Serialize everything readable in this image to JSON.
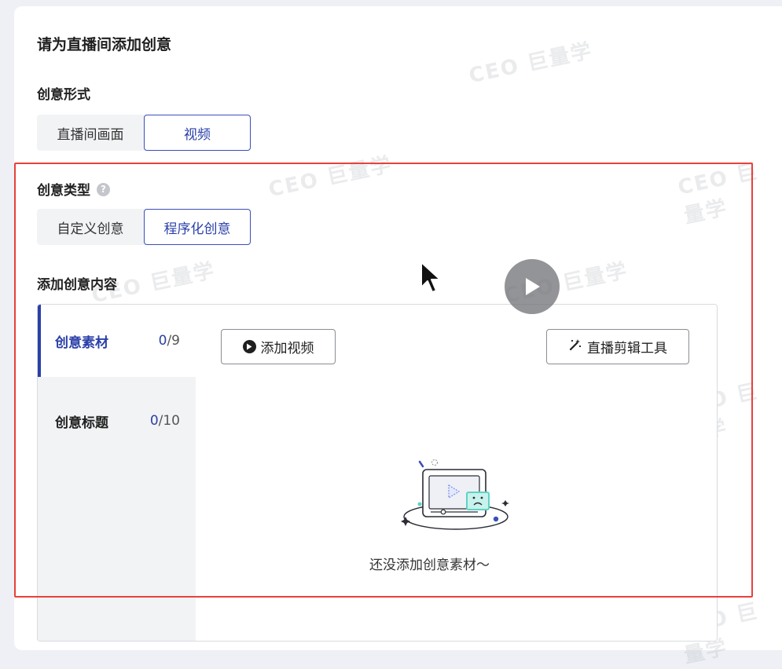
{
  "page": {
    "title": "请为直播间添加创意"
  },
  "creative_form": {
    "label": "创意形式",
    "options": [
      "直播间画面",
      "视频"
    ],
    "selected": "视频"
  },
  "creative_type": {
    "label": "创意类型",
    "help_glyph": "?",
    "options": [
      "自定义创意",
      "程序化创意"
    ],
    "selected": "程序化创意"
  },
  "content": {
    "label": "添加创意内容",
    "tabs": [
      {
        "label": "创意素材",
        "count_current": "0",
        "count_sep": "/9"
      },
      {
        "label": "创意标题",
        "count_current": "0",
        "count_sep": "/10"
      }
    ],
    "add_video_button": "添加视频",
    "edit_tool_button": "直播剪辑工具",
    "empty_text": "还没添加创意素材～"
  },
  "watermark_text": "巨量学",
  "colors": {
    "accent": "#2a3fa8",
    "highlight_frame": "#e8413a",
    "teal": "#5fd3c6"
  }
}
